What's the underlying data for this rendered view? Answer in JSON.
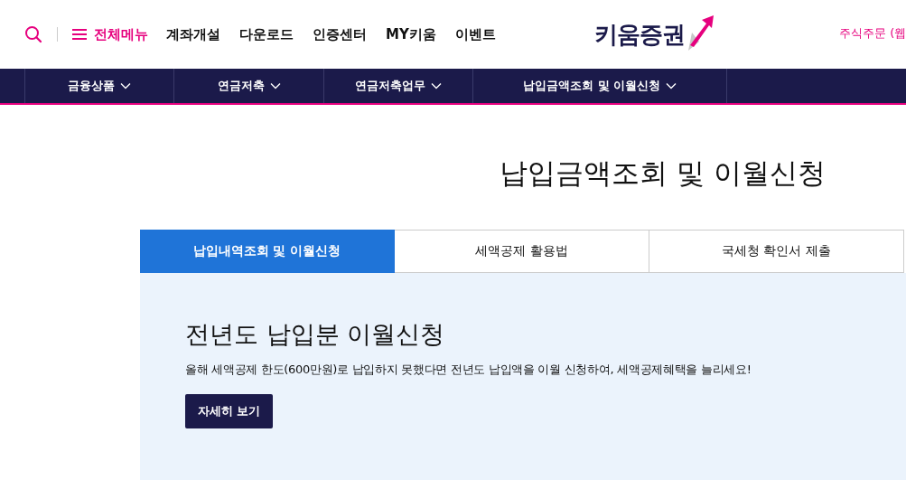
{
  "header": {
    "menu_label": "전체메뉴",
    "links": [
      "계좌개설",
      "다운로드",
      "인증센터",
      "MY키움",
      "이벤트"
    ],
    "logo": "키움증권",
    "right_link": "주식주문 (웹"
  },
  "nav": [
    {
      "label": "금융상품"
    },
    {
      "label": "연금저축"
    },
    {
      "label": "연금저축업무"
    },
    {
      "label": "납입금액조회 및 이월신청"
    }
  ],
  "page_title": "납입금액조회 및 이월신청",
  "tabs": [
    {
      "label": "납입내역조회 및 이월신청",
      "selected": true
    },
    {
      "label": "세액공제 활용법",
      "selected": false
    },
    {
      "label": "국세청 확인서 제출",
      "selected": false
    }
  ],
  "panel": {
    "heading": "전년도 납입분 이월신청",
    "description": "올해 세액공제 한도(600만원)로 납입하지 못했다면 전년도 납입액을 이월 신청하여, 세액공제혜택을 늘리세요!",
    "button": "자세히 보기"
  }
}
